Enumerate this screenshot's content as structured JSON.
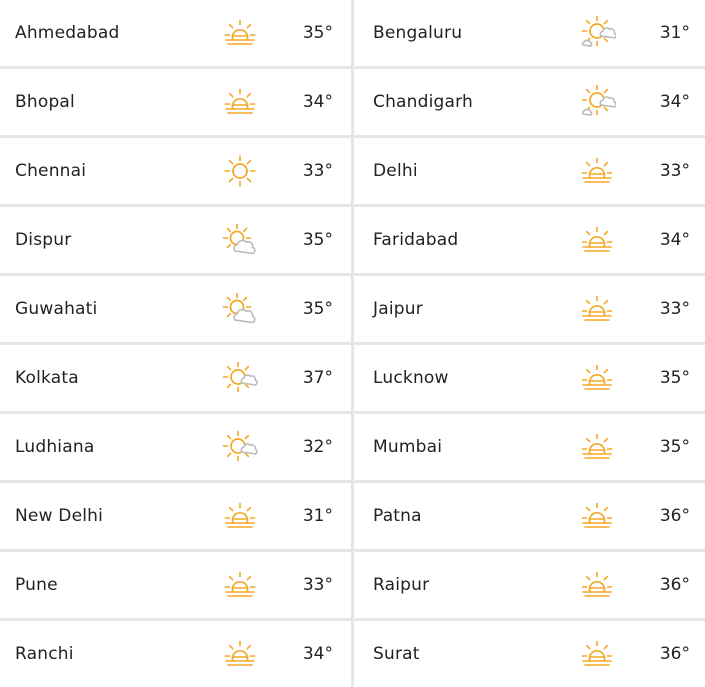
{
  "colors": {
    "sun": "#f5a623",
    "cloud": "#b9b9b9",
    "divider": "#e6e6e6",
    "text": "#222222"
  },
  "rows": [
    {
      "left": {
        "city": "Ahmedabad",
        "temp": "35°",
        "icon": "haze-sun-icon"
      },
      "right": {
        "city": "Bengaluru",
        "temp": "31°",
        "icon": "partly-cloudy-icon"
      }
    },
    {
      "left": {
        "city": "Bhopal",
        "temp": "34°",
        "icon": "haze-sun-icon"
      },
      "right": {
        "city": "Chandigarh",
        "temp": "34°",
        "icon": "partly-cloudy-icon"
      }
    },
    {
      "left": {
        "city": "Chennai",
        "temp": "33°",
        "icon": "sunny-icon"
      },
      "right": {
        "city": "Delhi",
        "temp": "33°",
        "icon": "haze-sun-icon"
      }
    },
    {
      "left": {
        "city": "Dispur",
        "temp": "35°",
        "icon": "sun-cloud-icon"
      },
      "right": {
        "city": "Faridabad",
        "temp": "34°",
        "icon": "haze-sun-icon"
      }
    },
    {
      "left": {
        "city": "Guwahati",
        "temp": "35°",
        "icon": "sun-cloud-icon"
      },
      "right": {
        "city": "Jaipur",
        "temp": "33°",
        "icon": "haze-sun-icon"
      }
    },
    {
      "left": {
        "city": "Kolkata",
        "temp": "37°",
        "icon": "sun-small-cloud-icon"
      },
      "right": {
        "city": "Lucknow",
        "temp": "35°",
        "icon": "haze-sun-icon"
      }
    },
    {
      "left": {
        "city": "Ludhiana",
        "temp": "32°",
        "icon": "sun-small-cloud-icon"
      },
      "right": {
        "city": "Mumbai",
        "temp": "35°",
        "icon": "haze-sun-icon"
      }
    },
    {
      "left": {
        "city": "New Delhi",
        "temp": "31°",
        "icon": "haze-sun-icon"
      },
      "right": {
        "city": "Patna",
        "temp": "36°",
        "icon": "haze-sun-icon"
      }
    },
    {
      "left": {
        "city": "Pune",
        "temp": "33°",
        "icon": "haze-sun-icon"
      },
      "right": {
        "city": "Raipur",
        "temp": "36°",
        "icon": "haze-sun-icon"
      }
    },
    {
      "left": {
        "city": "Ranchi",
        "temp": "34°",
        "icon": "haze-sun-icon"
      },
      "right": {
        "city": "Surat",
        "temp": "36°",
        "icon": "haze-sun-icon"
      }
    }
  ]
}
